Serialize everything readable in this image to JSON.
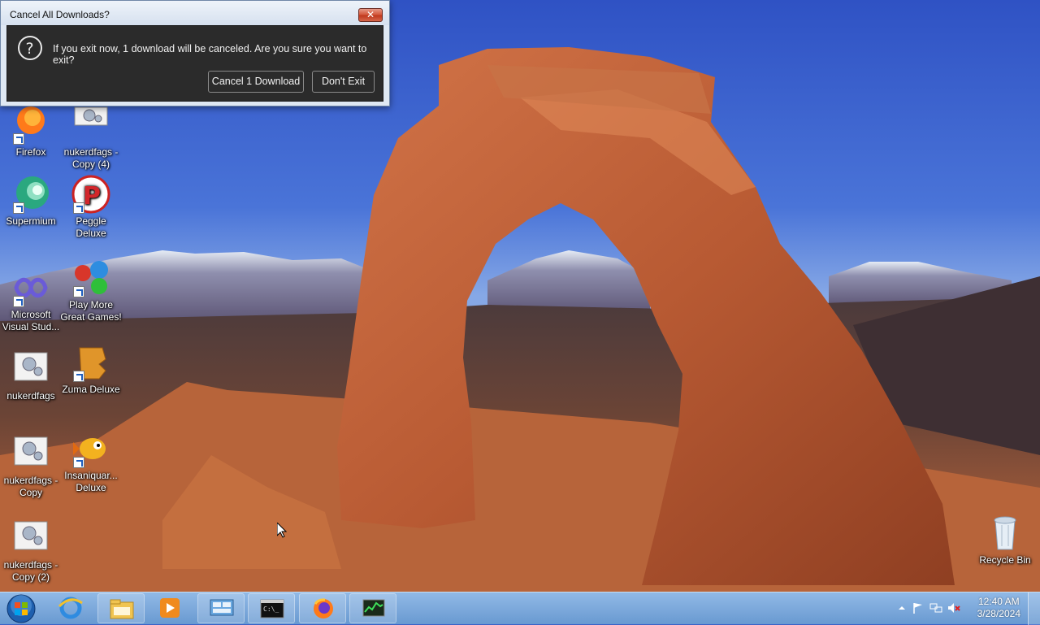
{
  "dialog": {
    "title": "Cancel All Downloads?",
    "message": "If you exit now, 1 download will be canceled. Are you sure you want to exit?",
    "cancel_button": "Cancel 1 Download",
    "stay_button": "Don't Exit",
    "close_symbol": "✕"
  },
  "desktop": {
    "icons": [
      {
        "label": "Firefox",
        "icon": "firefox-icon"
      },
      {
        "label": "nukerdfags - Copy (4)",
        "icon": "settings-app-icon"
      },
      {
        "label": "Supermium",
        "icon": "supermium-icon"
      },
      {
        "label": "Peggle Deluxe",
        "icon": "peggle-icon"
      },
      {
        "label": "Microsoft Visual Stud...",
        "icon": "visual-studio-icon"
      },
      {
        "label": "Play More Great Games!",
        "icon": "popcap-games-icon"
      },
      {
        "label": "nukerdfags",
        "icon": "settings-app-icon"
      },
      {
        "label": "Zuma Deluxe",
        "icon": "zuma-icon"
      },
      {
        "label": "nukerdfags - Copy",
        "icon": "settings-app-icon"
      },
      {
        "label": "Insaniquar... Deluxe",
        "icon": "insaniquarium-icon"
      },
      {
        "label": "nukerdfags - Copy (2)",
        "icon": "settings-app-icon"
      },
      {
        "label": "Recycle Bin",
        "icon": "recycle-bin-icon"
      }
    ]
  },
  "taskbar": {
    "clock_time": "12:40 AM",
    "clock_date": "3/28/2024",
    "buttons": [
      "internet-explorer-icon",
      "file-explorer-icon",
      "media-player-icon",
      "control-panel-icon",
      "command-prompt-icon",
      "firefox-icon",
      "task-manager-icon"
    ]
  },
  "colors": {
    "dialog_body": "#2b2b2b",
    "taskbar": "#7fa9d6",
    "sky": "#3c63c9"
  }
}
